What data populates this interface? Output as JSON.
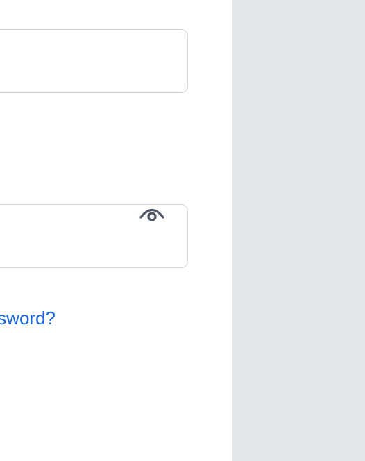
{
  "form": {
    "username_field": {
      "value": "",
      "placeholder": ""
    },
    "password_field": {
      "value": "",
      "placeholder": "",
      "toggle_icon": "eye-icon"
    },
    "forgot_password_label": "Forgot Password?"
  },
  "colors": {
    "link": "#1a66e0",
    "side_panel": "#e2e6eb",
    "input_border": "#d1d5db",
    "icon": "#4b5563"
  }
}
